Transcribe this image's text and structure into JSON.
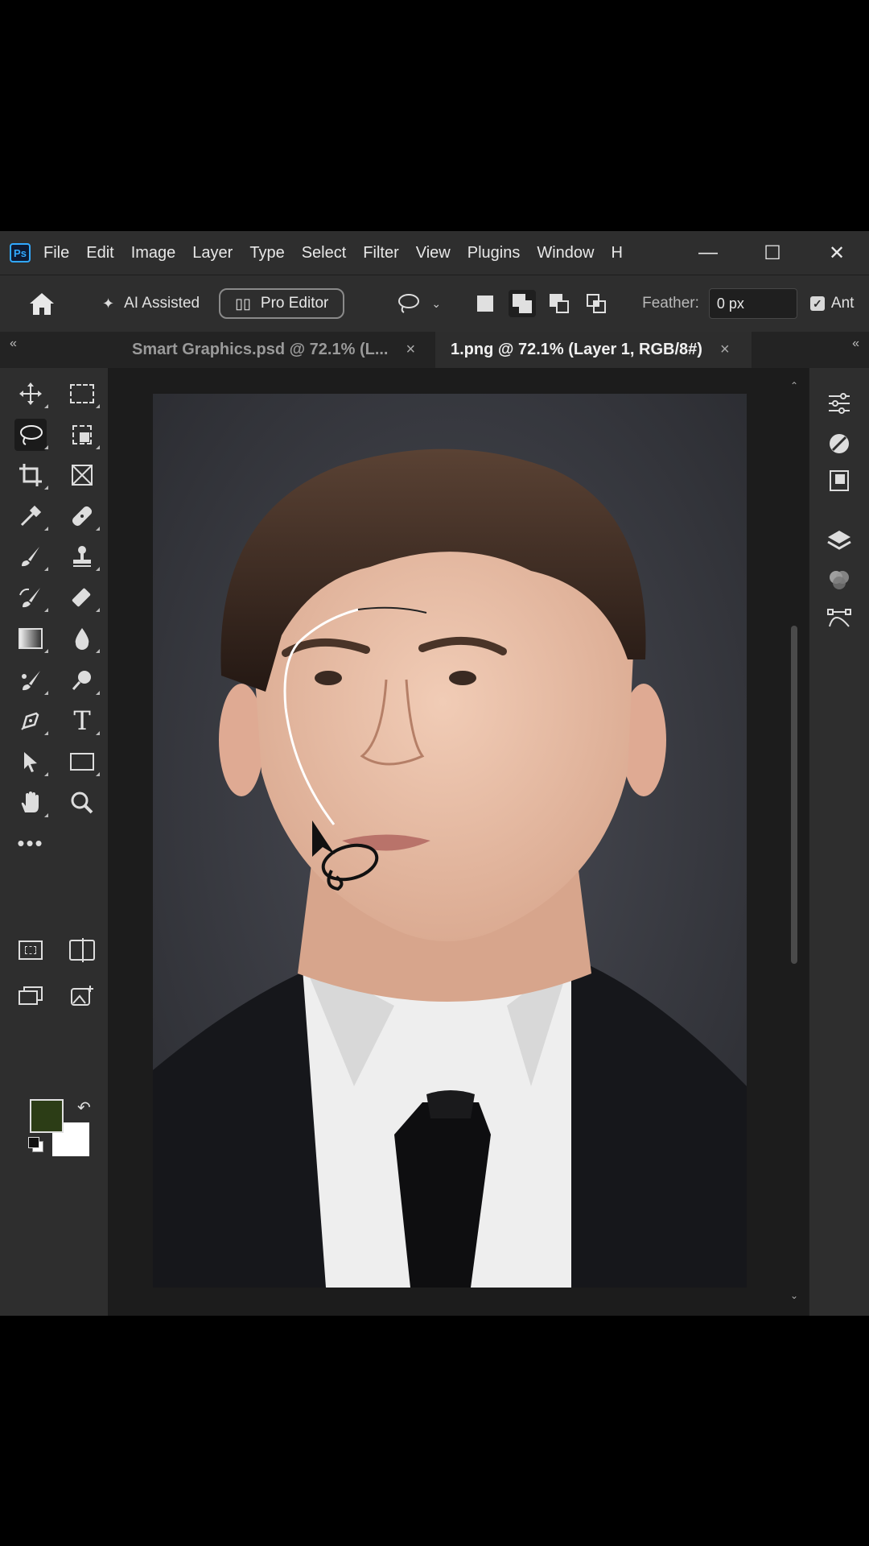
{
  "app": {
    "logo": "Ps",
    "menu": [
      "File",
      "Edit",
      "Image",
      "Layer",
      "Type",
      "Select",
      "Filter",
      "View",
      "Plugins",
      "Window",
      "H"
    ],
    "window_controls": {
      "minimize": "—",
      "maximize": "☐",
      "close": "✕"
    }
  },
  "options": {
    "ai_assisted": "AI Assisted",
    "pro_editor": "Pro Editor",
    "feather_label": "Feather:",
    "feather_value": "0 px",
    "anti_alias": "Ant"
  },
  "tabs": [
    {
      "label": "Smart Graphics.psd @ 72.1% (L...",
      "close": "×",
      "active": false
    },
    {
      "label": "1.png @ 72.1% (Layer 1, RGB/8#)",
      "close": "×",
      "active": true
    }
  ],
  "panel_collapse": {
    "left": "«",
    "right": "«"
  },
  "tools": [
    "move",
    "marquee",
    "lasso",
    "object-select",
    "crop",
    "frame",
    "eyedropper",
    "healing",
    "brush",
    "stamp",
    "history-brush",
    "eraser",
    "gradient",
    "blur",
    "dodge",
    "zoom-adjust",
    "pen",
    "type",
    "path-select",
    "rectangle",
    "hand",
    "zoom",
    "more"
  ],
  "colors": {
    "foreground": "#2c3d16",
    "background": "#ffffff",
    "accent": "#31a8ff"
  },
  "right_panel": [
    "adjustments-icon",
    "properties-icon",
    "libraries-icon",
    "layers-icon",
    "channels-icon",
    "paths-icon"
  ]
}
